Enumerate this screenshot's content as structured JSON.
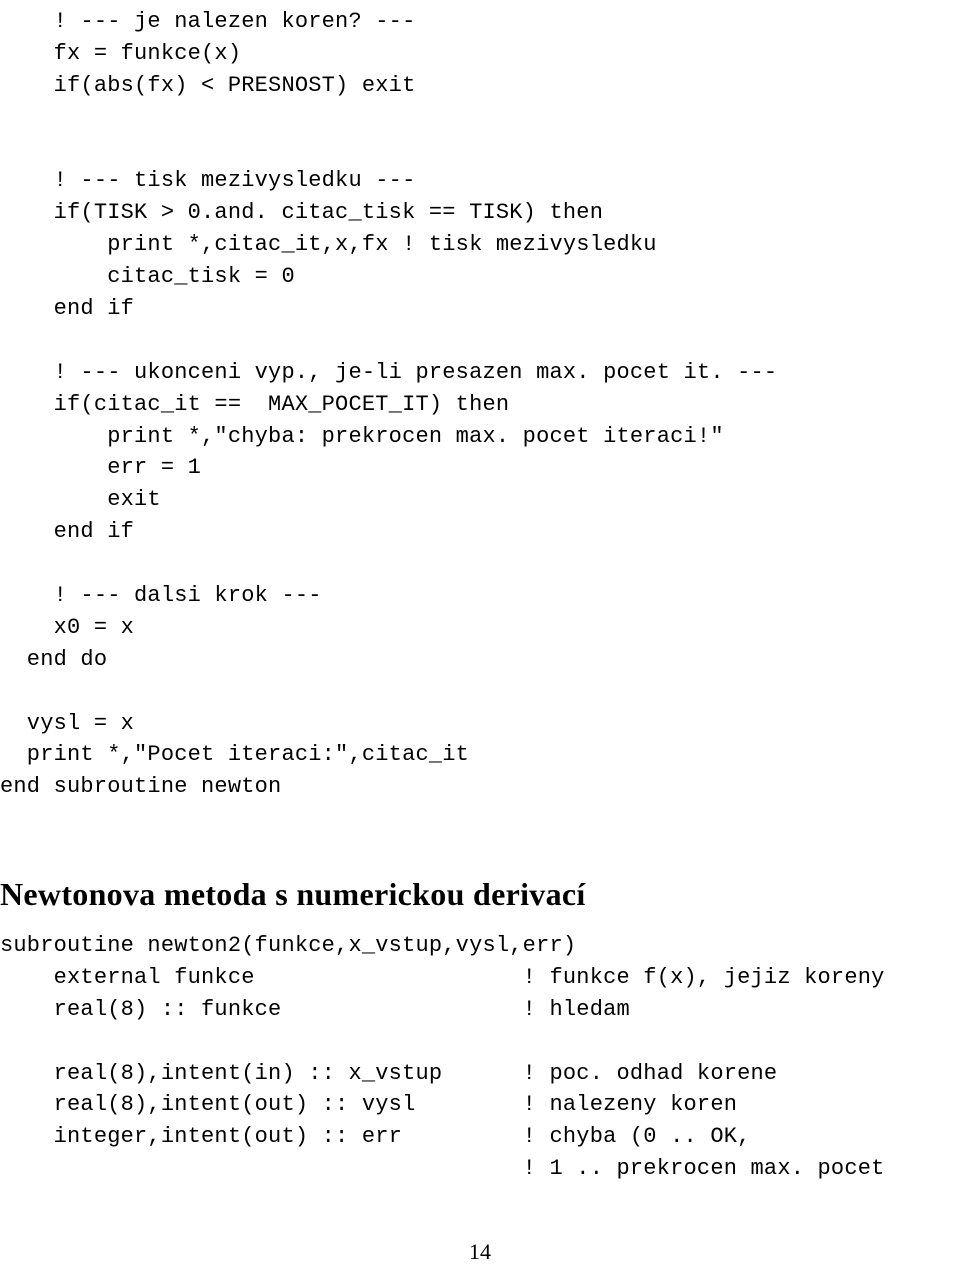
{
  "code1": {
    "l1": "    ! --- je nalezen koren? ---",
    "l2": "    fx = funkce(x)",
    "l3": "    if(abs(fx) < PRESNOST) exit",
    "l4": "",
    "l5": "",
    "l6": "    ! --- tisk mezivysledku ---",
    "l7": "    if(TISK > 0.and. citac_tisk == TISK) then",
    "l8": "        print *,citac_it,x,fx ! tisk mezivysledku",
    "l9": "        citac_tisk = 0",
    "l10": "    end if",
    "l11": "",
    "l12": "    ! --- ukonceni vyp., je-li presazen max. pocet it. ---",
    "l13": "    if(citac_it ==  MAX_POCET_IT) then",
    "l14": "        print *,\"chyba: prekrocen max. pocet iteraci!\"",
    "l15": "        err = 1",
    "l16": "        exit",
    "l17": "    end if",
    "l18": "",
    "l19": "    ! --- dalsi krok ---",
    "l20": "    x0 = x",
    "l21": "  end do",
    "l22": "",
    "l23": "  vysl = x",
    "l24": "  print *,\"Pocet iteraci:\",citac_it",
    "l25": "end subroutine newton"
  },
  "heading": "Newtonova metoda s numerickou derivací",
  "code2": {
    "l1": "subroutine newton2(funkce,x_vstup,vysl,err)",
    "l2": "    external funkce                    ! funkce f(x), jejiz koreny",
    "l3": "    real(8) :: funkce                  ! hledam",
    "l4": "",
    "l5": "    real(8),intent(in) :: x_vstup      ! poc. odhad korene",
    "l6": "    real(8),intent(out) :: vysl        ! nalezeny koren",
    "l7": "    integer,intent(out) :: err         ! chyba (0 .. OK,",
    "l8": "                                       ! 1 .. prekrocen max. pocet"
  },
  "page_number": "14"
}
